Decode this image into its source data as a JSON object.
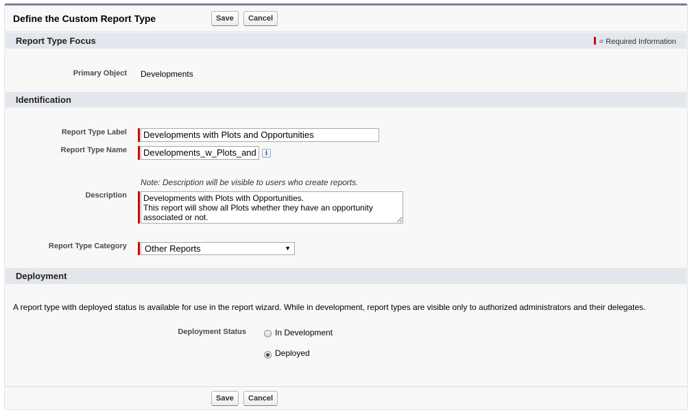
{
  "header": {
    "title": "Define the Custom Report Type",
    "save_label": "Save",
    "cancel_label": "Cancel"
  },
  "required_legend": "= Required Information",
  "focus_section": {
    "title": "Report Type Focus",
    "primary_object_label": "Primary Object",
    "primary_object_value": "Developments"
  },
  "identification": {
    "title": "Identification",
    "report_type_label_label": "Report Type Label",
    "report_type_label_value": "Developments with Plots and Opportunities",
    "report_type_name_label": "Report Type Name",
    "report_type_name_value": "Developments_w_Plots_and",
    "info_icon": "info-icon",
    "description_note": "Note: Description will be visible to users who create reports.",
    "description_label": "Description",
    "description_value": "Developments with Plots with Opportunities.\nThis report will show all Plots whether they have an opportunity associated or not.",
    "category_label": "Report Type Category",
    "category_value": "Other Reports"
  },
  "deployment": {
    "title": "Deployment",
    "description": "A report type with deployed status is available for use in the report wizard. While in development, report types are visible only to authorized administrators and their delegates.",
    "status_label": "Deployment Status",
    "options": [
      {
        "label": "In Development",
        "checked": false
      },
      {
        "label": "Deployed",
        "checked": true
      }
    ]
  },
  "footer": {
    "save_label": "Save",
    "cancel_label": "Cancel"
  },
  "colors": {
    "required": "#cc0000",
    "section_bg": "#e3e6ec",
    "panel_bg": "#f8f8f8"
  }
}
